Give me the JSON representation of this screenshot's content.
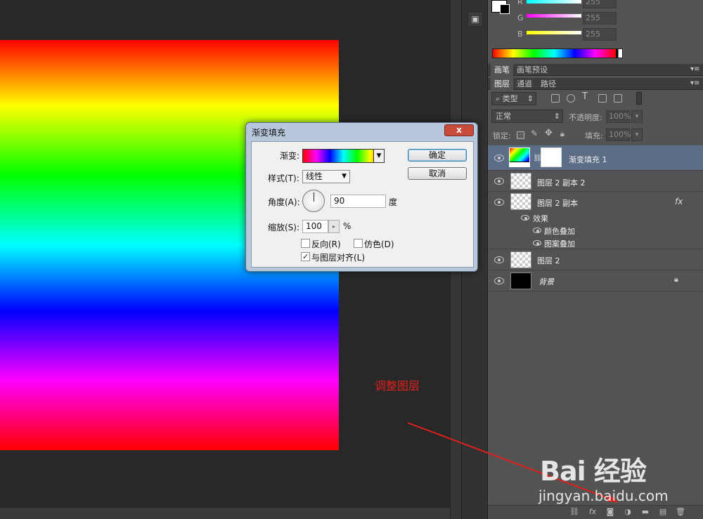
{
  "color_panel": {
    "channels": [
      {
        "label": "R",
        "value": "255",
        "gradient": "linear-gradient(to right,#00ffff,#ffffff)"
      },
      {
        "label": "G",
        "value": "255",
        "gradient": "linear-gradient(to right,#ff00ff,#ffffff)"
      },
      {
        "label": "B",
        "value": "255",
        "gradient": "linear-gradient(to right,#ffff00,#ffffff)"
      }
    ]
  },
  "brush_tabs": [
    "画笔",
    "画笔预设"
  ],
  "layer_tabs": [
    "图层",
    "通道",
    "路径"
  ],
  "layers_panel": {
    "filter_kind": "类型",
    "blend_mode": "正常",
    "opacity_label": "不透明度:",
    "opacity_value": "100%",
    "lock_label": "锁定:",
    "fill_label": "填充:",
    "fill_value": "100%",
    "layers": [
      {
        "name": "渐变填充 1",
        "selected": true
      },
      {
        "name": "图层 2 副本 2",
        "selected": false
      },
      {
        "name": "图层 2 副本",
        "selected": false,
        "fx": "fx"
      },
      {
        "name": "图层 2",
        "selected": false
      },
      {
        "name": "背景",
        "selected": false
      }
    ],
    "effects_label": "效果",
    "effects": [
      "颜色叠加",
      "图案叠加"
    ]
  },
  "dialog": {
    "title": "渐变填充",
    "close": "x",
    "gradient_label": "渐变:",
    "style_label": "样式(T):",
    "style_value": "线性",
    "angle_label": "角度(A):",
    "angle_value": "90",
    "angle_unit": "度",
    "scale_label": "缩放(S):",
    "scale_value": "100",
    "scale_unit": "%",
    "reverse_label": "反向(R)",
    "reverse_checked": false,
    "dither_label": "仿色(D)",
    "dither_checked": false,
    "align_label": "与图层对齐(L)",
    "align_checked": true,
    "ok_label": "确定",
    "cancel_label": "取消"
  },
  "annotation": "调整图层",
  "watermark": {
    "brand": "Bai 经验",
    "url": "jingyan.baidu.com"
  }
}
